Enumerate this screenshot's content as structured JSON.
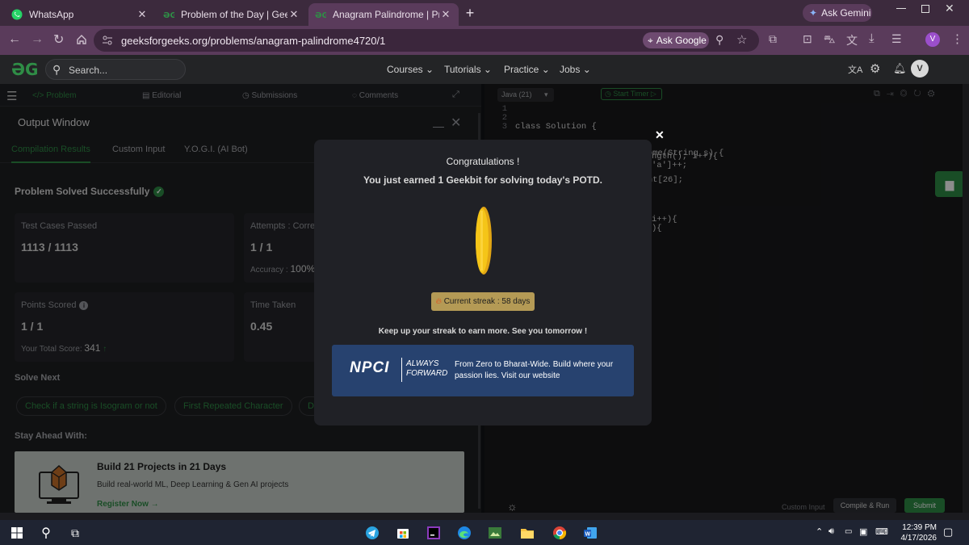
{
  "browser": {
    "tabs": [
      {
        "label": "WhatsApp",
        "active": false
      },
      {
        "label": "Problem of the Day | GeeksforG",
        "active": false
      },
      {
        "label": "Anagram Palindrome | Practice |",
        "active": true
      }
    ],
    "new_tab_symbol": "+",
    "ask_gemini": "Ask Gemini",
    "url": "geeksforgeeks.org/problems/anagram-palindrome4720/1",
    "ask_google": "Ask Google",
    "profile_initial": "V"
  },
  "gfg_nav": {
    "search_placeholder": "Search...",
    "menu": [
      "Courses",
      "Tutorials",
      "Practice",
      "Jobs"
    ],
    "avatar_initial": "V"
  },
  "problem_tabs": [
    "Problem",
    "Editorial",
    "Submissions",
    "Comments"
  ],
  "output_window": {
    "title": "Output Window",
    "tabs": [
      "Compilation Results",
      "Custom Input",
      "Y.O.G.I. (AI Bot)"
    ],
    "status": "Problem Solved Successfully",
    "test_cases_label": "Test Cases Passed",
    "test_cases_value": "1113 / 1113",
    "attempts_label": "Attempts : Correc",
    "attempts_value": "1 / 1",
    "accuracy_label": "Accuracy :",
    "accuracy_value": "100%",
    "points_label": "Points Scored",
    "points_value": "1 / 1",
    "total_score_label": "Your Total Score:",
    "total_score_value": "341",
    "time_label": "Time Taken",
    "time_value": "0.45",
    "solve_next_label": "Solve Next",
    "solve_next": [
      "Check if a string is Isogram or not",
      "First Repeated Character",
      "D"
    ],
    "stay_ahead_label": "Stay Ahead With:",
    "promo_title": "Build 21 Projects in 21 Days",
    "promo_subtitle": "Build real-world ML, Deep Learning & Gen AI projects",
    "promo_link": "Register Now →"
  },
  "editor": {
    "language": "Java (21)",
    "start_timer": "Start Timer",
    "line_numbers": [
      "1",
      "2",
      "3"
    ],
    "code_lines": [
      "class Solution {",
      "    boolean canFormPalindrome(String s) {",
      "        int[] freq = new int[26];"
    ],
    "partial_lines": [
      "ngth(); i++){",
      "'a']++;",
      "i++){",
      "){"
    ],
    "custom_input": "Custom Input",
    "compile_run": "Compile & Run",
    "submit": "Submit"
  },
  "modal": {
    "title": "Congratulations !",
    "subtitle": "You just earned 1 Geekbit for solving today's POTD.",
    "streak": "Current streak : 58 days",
    "footer": "Keep up your streak to earn more. See you tomorrow !",
    "close_symbol": "✕",
    "ad_logo": "NPCI",
    "ad_tagline_1": "ALWAYS",
    "ad_tagline_2": "FORWARD",
    "ad_text": "From Zero to Bharat-Wide. Build where your passion lies. Visit our website"
  },
  "taskbar": {
    "time": "12:39 PM",
    "date": "4/17/2026"
  },
  "colors": {
    "accent_green": "#2f8d46",
    "coin_gold": "#f5c518",
    "streak_badge": "#b49a55",
    "ad_blue": "#27426f",
    "gemini_blue": "#8ab4f8"
  },
  "icons": [
    "whatsapp-icon",
    "gfg-icon",
    "back-icon",
    "forward-icon",
    "reload-icon",
    "home-icon",
    "search-icon",
    "gear-icon",
    "bell-icon",
    "check-circle-icon",
    "info-icon",
    "close-icon",
    "fire-icon",
    "windows-start-icon",
    "telegram-icon",
    "edge-icon",
    "chrome-icon",
    "folder-icon",
    "word-icon",
    "wifi-icon",
    "volume-icon",
    "battery-icon",
    "chat-icon"
  ]
}
